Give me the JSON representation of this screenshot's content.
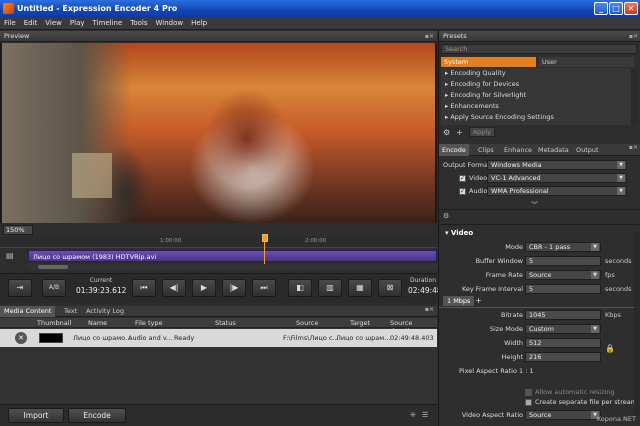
{
  "window": {
    "title": "Untitled - Expression Encoder 4 Pro"
  },
  "menu": [
    "File",
    "Edit",
    "View",
    "Play",
    "Timeline",
    "Tools",
    "Window",
    "Help"
  ],
  "preview": {
    "header": "Preview",
    "zoom": "150%"
  },
  "timeline": {
    "ticks": [
      "1:00:00",
      "2:00:00"
    ],
    "clip_name": "Лицо со шрамом (1983) HDTVRip.avi"
  },
  "transport": {
    "ab_label": "A/B",
    "current_label": "Current",
    "current_time": "01:39:23.612",
    "duration_label": "Duration",
    "duration_time": "02:49:48"
  },
  "media": {
    "tabs": [
      "Media Content",
      "Text",
      "Activity Log"
    ],
    "columns": [
      "Thumbnail",
      "Name",
      "File type",
      "Status",
      "Source",
      "Target",
      "Source duratio"
    ],
    "rows": [
      {
        "name": "Лицо со шрамо...",
        "file_type": "Audio and v...",
        "status": "Ready",
        "source": "F:\\Films\\Лицо с...",
        "target": "Лицо со шрам...",
        "duration": "02:49:48.403"
      }
    ],
    "import_label": "Import",
    "encode_label": "Encode"
  },
  "presets": {
    "header": "Presets",
    "search_placeholder": "Search",
    "tabs": [
      "System",
      "User"
    ],
    "items": [
      "Encoding Quality",
      "Encoding for Devices",
      "Encoding for Silverlight",
      "Enhancements",
      "Apply Source Encoding Settings"
    ],
    "apply_label": "Apply"
  },
  "encode": {
    "tabs": [
      "Encode",
      "Clips",
      "Enhance",
      "Metadata",
      "Output"
    ],
    "output_format_label": "Output Format",
    "output_format": "Windows Media",
    "video_label": "Video",
    "video_codec": "VC-1 Advanced",
    "audio_label": "Audio",
    "audio_codec": "WMA Professional",
    "section_video": "Video",
    "mode_label": "Mode",
    "mode": "CBR - 1 pass",
    "buffer_label": "Buffer Window",
    "buffer": "5",
    "buffer_unit": "seconds",
    "framerate_label": "Frame Rate",
    "framerate": "Source",
    "framerate_unit": "fps",
    "keyframe_label": "Key Frame Interval",
    "keyframe": "5",
    "keyframe_unit": "seconds",
    "stream_tab": "1 Mbps",
    "bitrate_label": "Bitrate",
    "bitrate": "1045",
    "bitrate_unit": "Kbps",
    "sizemode_label": "Size Mode",
    "sizemode": "Custom",
    "width_label": "Width",
    "width": "512",
    "height_label": "Height",
    "height": "216",
    "pixel_aspect": "Pixel Aspect Ratio 1 : 1",
    "allow_resizing": "Allow automatic resizing",
    "separate_file": "Create separate file per stream",
    "video_aspect_label": "Video Aspect Ratio",
    "video_aspect": "Source"
  },
  "watermark": "Kopona.NET"
}
